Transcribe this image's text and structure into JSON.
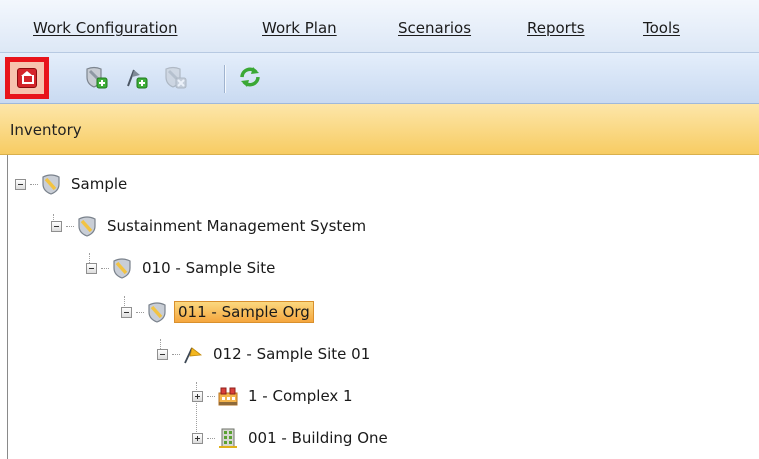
{
  "menubar": {
    "items": [
      {
        "label": "Work Configuration"
      },
      {
        "label": "Work Plan"
      },
      {
        "label": "Scenarios"
      },
      {
        "label": "Reports"
      },
      {
        "label": "Tools"
      }
    ]
  },
  "toolbar": {
    "buttons": [
      {
        "icon": "home-icon",
        "active": true
      },
      {
        "icon": "add-shield-icon"
      },
      {
        "icon": "add-flag-icon"
      },
      {
        "icon": "remove-shield-icon",
        "disabled": true
      },
      {
        "icon": "refresh-icon"
      }
    ]
  },
  "panel": {
    "title": "Inventory"
  },
  "tree": {
    "nodes": [
      {
        "label": "Sample",
        "icon": "shield-icon",
        "expanded": true
      },
      {
        "label": "Sustainment Management System",
        "icon": "shield-icon",
        "expanded": true
      },
      {
        "label": "010 - Sample Site",
        "icon": "shield-icon",
        "expanded": true
      },
      {
        "label": "011 - Sample Org",
        "icon": "shield-icon",
        "expanded": true,
        "selected": true
      },
      {
        "label": "012 - Sample Site 01",
        "icon": "flag-icon",
        "expanded": true
      },
      {
        "label": "1 - Complex 1",
        "icon": "complex-icon",
        "expanded": false
      },
      {
        "label": "001 - Building One",
        "icon": "building-icon",
        "expanded": false
      }
    ]
  },
  "colors": {
    "highlight_border": "#e8141b",
    "panel_header": "#f7cc63",
    "selection": "#f5a63e"
  }
}
